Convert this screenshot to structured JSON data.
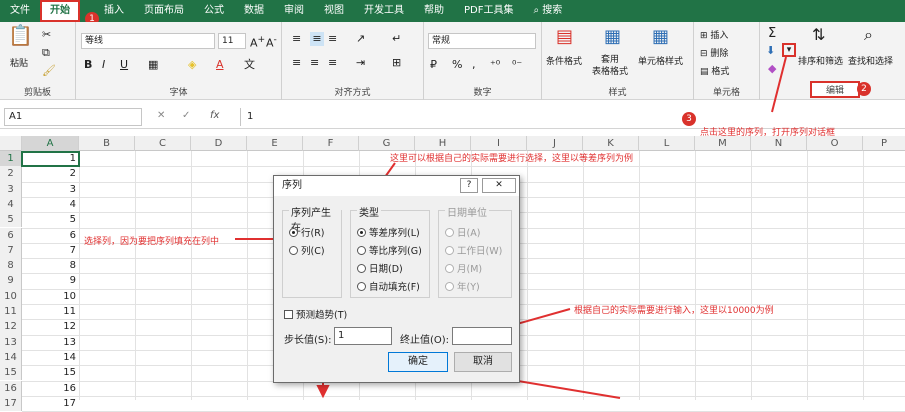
{
  "tabs": [
    "文件",
    "开始",
    "插入",
    "页面布局",
    "公式",
    "数据",
    "审阅",
    "视图",
    "开发工具",
    "帮助",
    "PDF工具集",
    "搜索"
  ],
  "badges": {
    "b1": "1",
    "b2": "2",
    "b3": "3"
  },
  "ribbon": {
    "paste": "粘贴",
    "clipboard": "剪贴板",
    "font_name": "等线",
    "font_size": "11",
    "font_group": "字体",
    "align_group": "对齐方式",
    "number_format": "常规",
    "number_group": "数字",
    "cond_format": "条件格式",
    "table_format": "套用\n表格格式",
    "cell_style": "单元格样式",
    "style_group": "样式",
    "insert": "插入",
    "delete": "删除",
    "format": "格式",
    "cells_group": "单元格",
    "sigma": "Σ",
    "sort_filter": "排序和筛选",
    "find_select": "查找和选择",
    "edit_group": "编辑"
  },
  "formula": {
    "namebox": "A1",
    "value": "1",
    "fx": "fx"
  },
  "columns": [
    "A",
    "B",
    "C",
    "D",
    "E",
    "F",
    "G",
    "H",
    "I",
    "J",
    "K",
    "L",
    "M",
    "N",
    "O",
    "P"
  ],
  "rows": [
    "1",
    "2",
    "3",
    "4",
    "5",
    "6",
    "7",
    "8",
    "9",
    "10",
    "11",
    "12",
    "13",
    "14",
    "15",
    "16",
    "17"
  ],
  "cells_a": [
    "1",
    "2",
    "3",
    "4",
    "5",
    "6",
    "7",
    "8",
    "9",
    "10",
    "11",
    "12",
    "13",
    "14",
    "15",
    "16",
    "17"
  ],
  "annotations": {
    "a1": "这里可以根据自己的实际需要进行选择，这里以等差序列为例",
    "a2": "选择列，因为要把序列填充在列中",
    "a3": "点击这里的序列，打开序列对话框",
    "a4": "根据自己的实际需要进行输入，这里以10000为例"
  },
  "dialog": {
    "title": "序列",
    "help": "?",
    "close": "✕",
    "series_in": "序列产生在",
    "row": "行(R)",
    "col": "列(C)",
    "type": "类型",
    "linear": "等差序列(L)",
    "growth": "等比序列(G)",
    "date": "日期(D)",
    "autofill": "自动填充(F)",
    "date_unit": "日期单位",
    "day": "日(A)",
    "weekday": "工作日(W)",
    "month": "月(M)",
    "year": "年(Y)",
    "trend": "预测趋势(T)",
    "step_label": "步长值(S):",
    "step_value": "1",
    "stop_label": "终止值(O):",
    "stop_value": "",
    "ok": "确定",
    "cancel": "取消"
  }
}
